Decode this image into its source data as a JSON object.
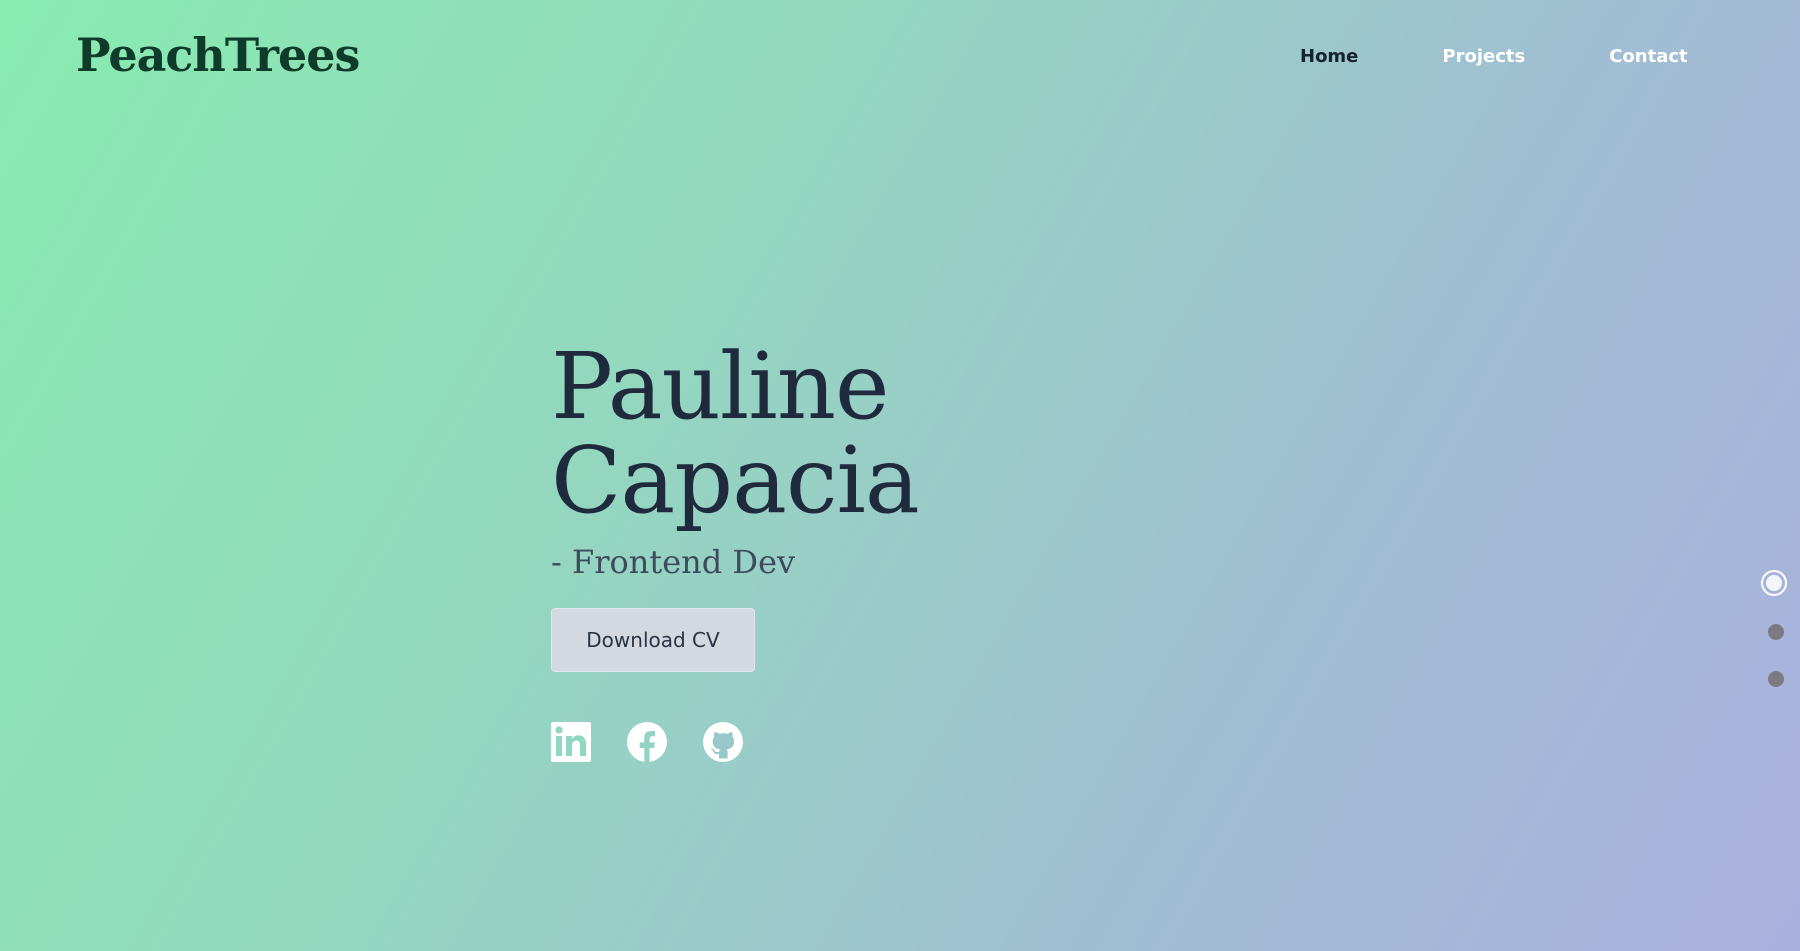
{
  "brand": {
    "logo_text": "PeachTrees"
  },
  "nav": {
    "items": [
      {
        "label": "Home",
        "active": true
      },
      {
        "label": "Projects",
        "active": false
      },
      {
        "label": "Contact",
        "active": false
      }
    ]
  },
  "hero": {
    "first_name": "Pauline",
    "last_name": "Capacia",
    "role": "- Frontend Dev",
    "cv_button_label": "Download CV"
  },
  "socials": [
    {
      "icon": "linkedin-icon"
    },
    {
      "icon": "facebook-icon"
    },
    {
      "icon": "github-icon"
    }
  ],
  "section_dots": {
    "count": 3,
    "active_index": 0
  },
  "colors": {
    "gradient_start": "#88ecb0",
    "gradient_end": "#aab0de",
    "logo": "#0f3b2a",
    "heading": "#1f2a3d",
    "nav_active": "#15222f",
    "nav_inactive": "#ffffff",
    "button_bg": "#d4d8e1"
  }
}
